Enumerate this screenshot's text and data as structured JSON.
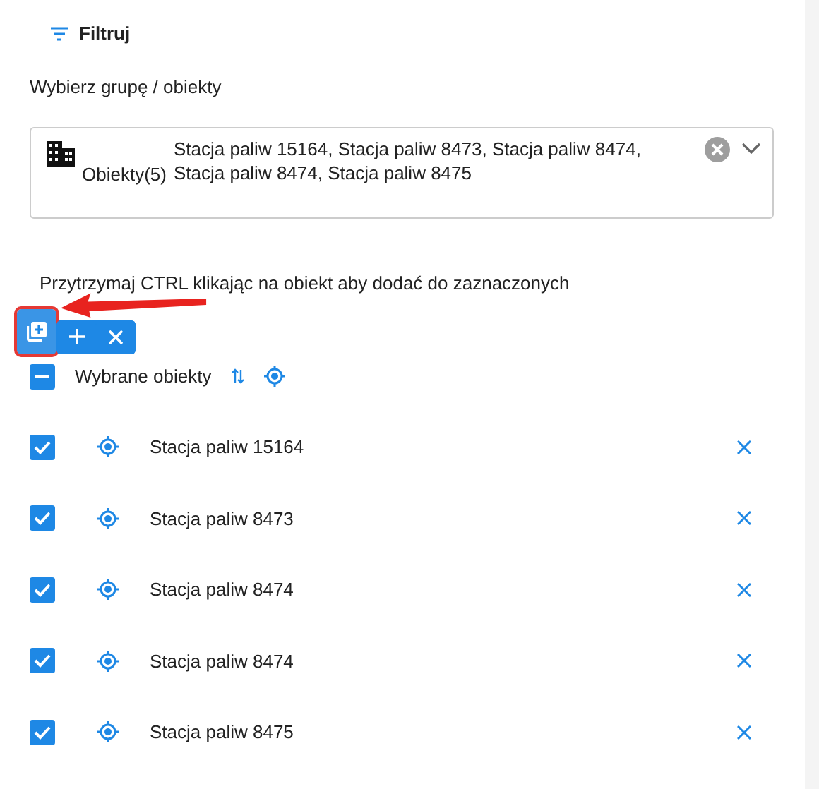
{
  "filter": {
    "label": "Filtruj"
  },
  "select": {
    "label": "Wybierz grupę / obiekty",
    "prefix": "Obiekty(5)",
    "value": "Stacja paliw 15164, Stacja paliw 8473, Stacja paliw 8474, Stacja paliw 8474, Stacja paliw 8475"
  },
  "hint": "Przytrzymaj CTRL klikając na obiekt aby dodać do zaznaczonych",
  "toolbar": [
    {
      "kind": "add-selected",
      "highlighted": true
    },
    {
      "kind": "add",
      "highlighted": false
    },
    {
      "kind": "clear",
      "highlighted": false
    }
  ],
  "header": {
    "label": "Wybrane obiekty",
    "indeterminate": true
  },
  "items": [
    {
      "name": "Stacja paliw 15164",
      "checked": true
    },
    {
      "name": "Stacja paliw 8473",
      "checked": true
    },
    {
      "name": "Stacja paliw 8474",
      "checked": true
    },
    {
      "name": "Stacja paliw 8474",
      "checked": true
    },
    {
      "name": "Stacja paliw 8475",
      "checked": true
    }
  ]
}
